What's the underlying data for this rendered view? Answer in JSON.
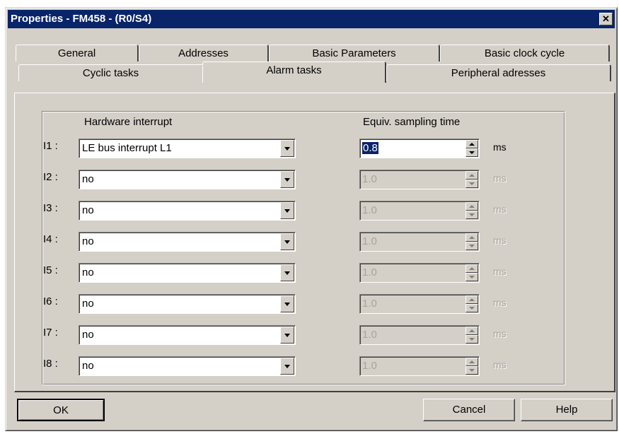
{
  "window": {
    "title": "Properties - FM458 - (R0/S4)",
    "close_label": "✕"
  },
  "tabs": {
    "back_row": [
      "General",
      "Addresses",
      "Basic Parameters",
      "Basic clock cycle"
    ],
    "front_row": [
      "Cyclic tasks",
      "Alarm tasks",
      "Peripheral adresses"
    ],
    "active": "Alarm tasks"
  },
  "panel": {
    "col_hardware_interrupt": "Hardware interrupt",
    "col_sampling_time": "Equiv. sampling time",
    "rows": [
      {
        "label": "I1 :",
        "interrupt": "LE bus interrupt L1",
        "time": "0.8",
        "unit": "ms",
        "enabled": true
      },
      {
        "label": "I2 :",
        "interrupt": "no",
        "time": "1.0",
        "unit": "ms",
        "enabled": false
      },
      {
        "label": "I3 :",
        "interrupt": "no",
        "time": "1.0",
        "unit": "ms",
        "enabled": false
      },
      {
        "label": "I4 :",
        "interrupt": "no",
        "time": "1.0",
        "unit": "ms",
        "enabled": false
      },
      {
        "label": "I5 :",
        "interrupt": "no",
        "time": "1.0",
        "unit": "ms",
        "enabled": false
      },
      {
        "label": "I6 :",
        "interrupt": "no",
        "time": "1.0",
        "unit": "ms",
        "enabled": false
      },
      {
        "label": "I7 :",
        "interrupt": "no",
        "time": "1.0",
        "unit": "ms",
        "enabled": false
      },
      {
        "label": "I8 :",
        "interrupt": "no",
        "time": "1.0",
        "unit": "ms",
        "enabled": false
      }
    ]
  },
  "buttons": {
    "ok": "OK",
    "cancel": "Cancel",
    "help": "Help"
  },
  "colors": {
    "titlebar": "#0a246a",
    "face": "#d4d0c8",
    "selection": "#0a246a"
  }
}
